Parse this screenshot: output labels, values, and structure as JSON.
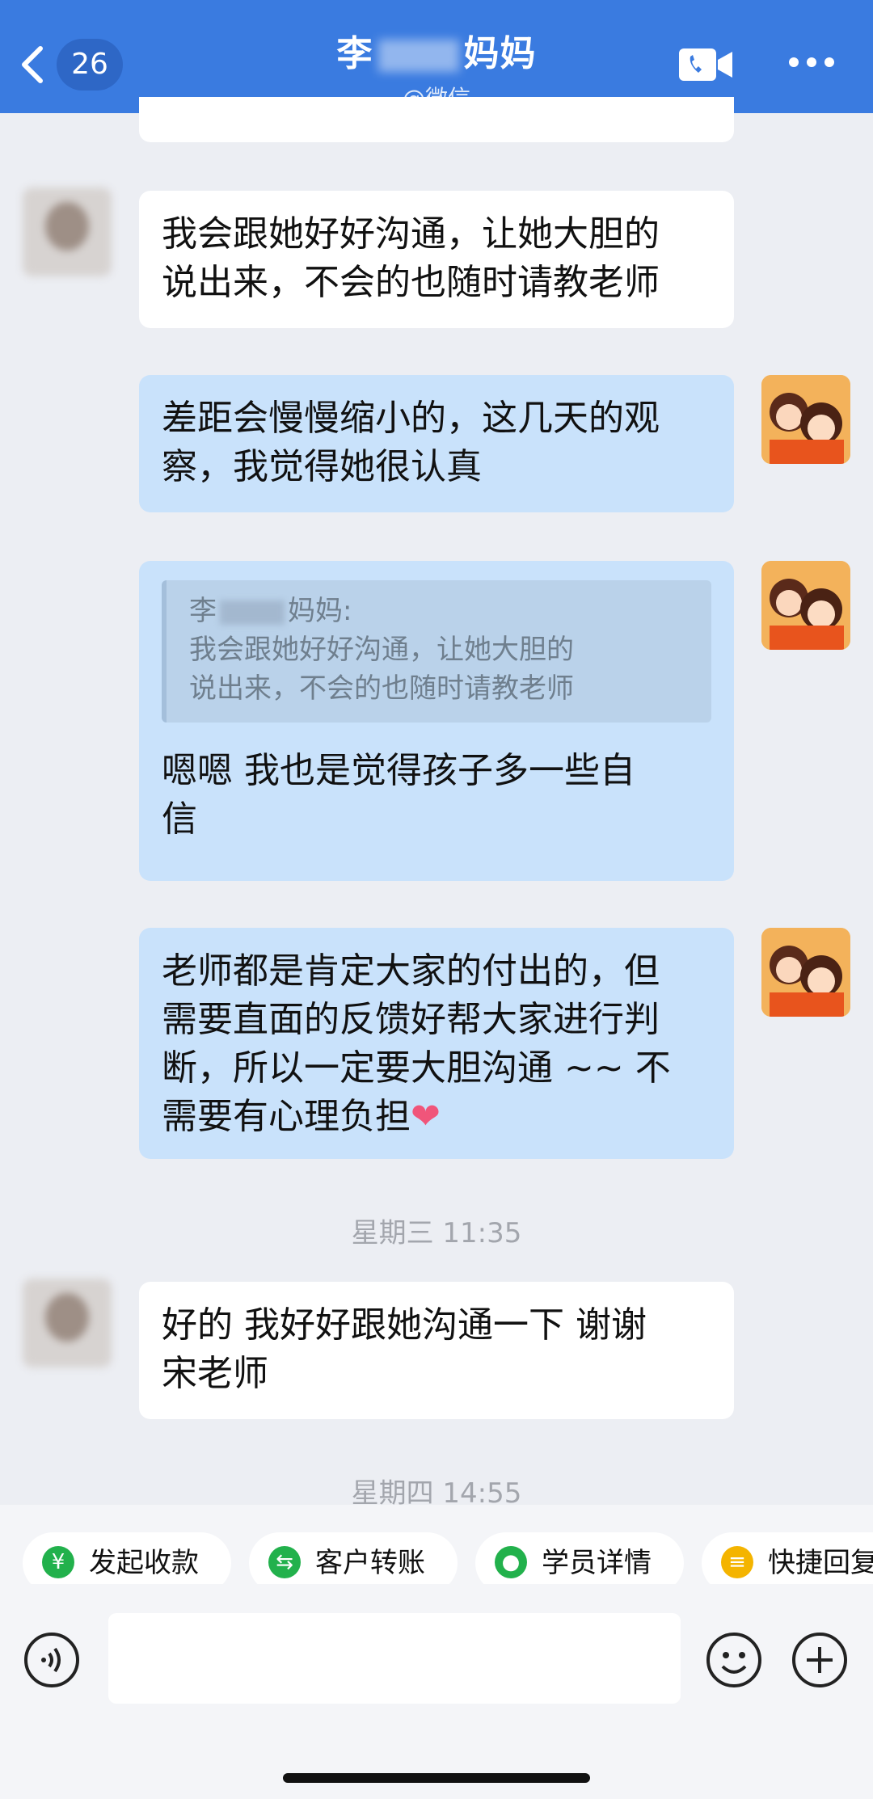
{
  "header": {
    "back_count": "26",
    "title_prefix": "李",
    "title_suffix": "妈妈",
    "subtitle": "@微信",
    "video_icon": "video-call-icon",
    "more_icon": "more-dots-icon",
    "bg_color": "#3a7be0"
  },
  "messages": [
    {
      "side": "in",
      "text": "我会跟她好好沟通，让她大胆的\n说出来，不会的也随时请教老师"
    },
    {
      "side": "out",
      "text": "差距会慢慢缩小的，这几天的观\n察，我觉得她很认真"
    },
    {
      "side": "out",
      "quote_name_prefix": "李",
      "quote_name_suffix": "妈妈:",
      "quote_text": "我会跟她好好沟通，让她大胆的\n说出来，不会的也随时请教老师",
      "text": "嗯嗯  我也是觉得孩子多一些自\n信"
    },
    {
      "side": "out",
      "text": "老师都是肯定大家的付出的，但\n需要直面的反馈好帮大家进行判\n断，所以一定要大胆沟通 ~~ 不\n需要有心理负担",
      "emoji": "❤"
    },
    {
      "side": "time",
      "text": "星期三 11:35"
    },
    {
      "side": "in",
      "text": "好的 我好好跟她沟通一下 谢谢\n宋老师"
    },
    {
      "side": "time",
      "text": "星期四 14:55"
    }
  ],
  "quick_actions": [
    {
      "label": "发起收款",
      "icon": "yuan-shield-icon",
      "color": "#22b14c"
    },
    {
      "label": "客户转账",
      "icon": "transfer-icon",
      "color": "#22b14c"
    },
    {
      "label": "学员详情",
      "icon": "student-profile-icon",
      "color": "#22b14c"
    },
    {
      "label": "快捷回复",
      "icon": "quick-reply-icon",
      "color": "#f4b400"
    }
  ],
  "input": {
    "voice_icon": "voice-icon",
    "emoji_icon": "emoji-icon",
    "add_icon": "add-icon",
    "placeholder": ""
  }
}
